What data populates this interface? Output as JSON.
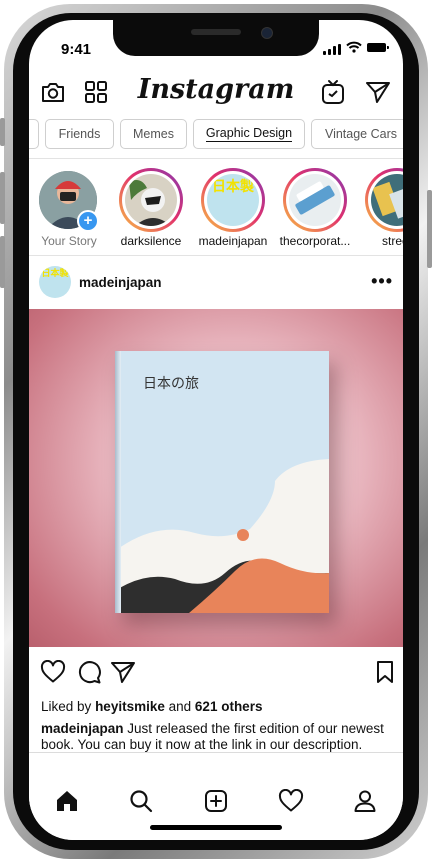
{
  "status_bar": {
    "time": "9:41"
  },
  "header": {
    "logo": "Instagram",
    "icons": [
      "camera-icon",
      "grid-icon",
      "igtv-icon",
      "direct-message-icon"
    ]
  },
  "chips": [
    {
      "label": "Friends"
    },
    {
      "label": "Memes"
    },
    {
      "label": "Graphic Design",
      "active": true
    },
    {
      "label": "Vintage Cars"
    }
  ],
  "stories": [
    {
      "name": "Your Story",
      "own": true
    },
    {
      "name": "darksilence"
    },
    {
      "name": "madeinjapan",
      "avatar_text": "日本製"
    },
    {
      "name": "thecorporat..."
    },
    {
      "name": "street"
    }
  ],
  "post": {
    "username": "madeinjapan",
    "avatar_text": "日本製",
    "book_title": "日本の旅",
    "likes_prefix": "Liked by",
    "likes_user": "heyitsmike",
    "likes_mid": "and",
    "likes_count": "621 others",
    "caption_user": "madeinjapan",
    "caption_text": "Just released the first edition of our newest book. You can buy it now at the link in our description."
  },
  "bottom_nav": [
    "home-icon",
    "search-icon",
    "new-post-icon",
    "activity-heart-icon",
    "profile-icon"
  ],
  "colors": {
    "accent_blue": "#3897f0",
    "post_bg": "#c7707d",
    "book_cover": "#d2e5f2",
    "book_orange": "#e8845a"
  }
}
